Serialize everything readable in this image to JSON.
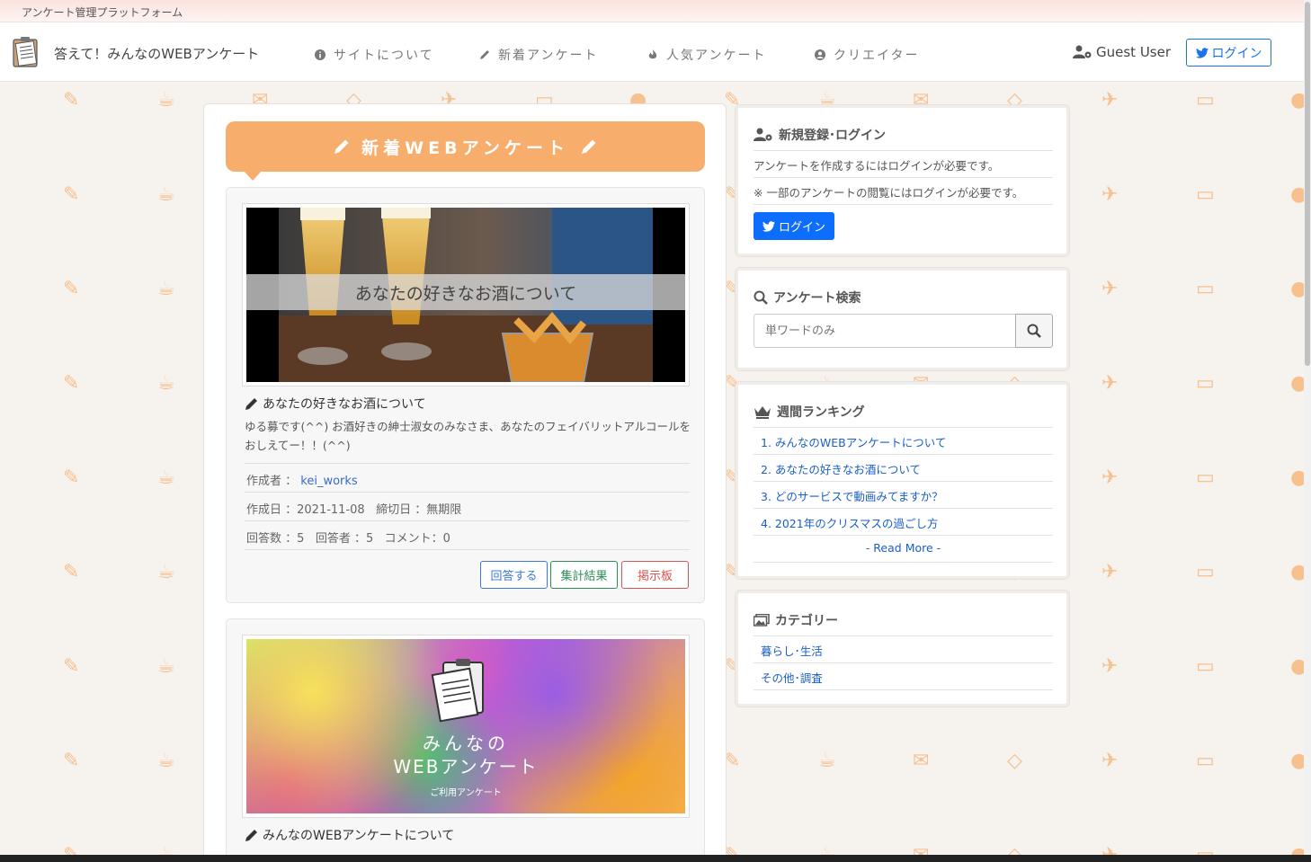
{
  "topstrip": {
    "title": "アンケート管理プラットフォーム"
  },
  "navbar": {
    "brand": "答えて！みんなのWEBアンケート",
    "items": [
      {
        "label": "サイトについて",
        "icon": "info-icon"
      },
      {
        "label": "新着アンケート",
        "icon": "pencil-icon"
      },
      {
        "label": "人気アンケート",
        "icon": "fire-icon"
      },
      {
        "label": "クリエイター",
        "icon": "user-circle-icon"
      }
    ],
    "user": "Guest User",
    "login": "ログイン"
  },
  "main": {
    "heading": "新着WEBアンケート",
    "cards": [
      {
        "thumb_caption": "あなたの好きなお酒について",
        "title": "あなたの好きなお酒について",
        "description": "ゆる募です(^^) お酒好きの紳士淑女のみなさま、あなたのフェイバリットアルコールをおしえてー！！(^^)",
        "author_label": "作成者 ：",
        "author": "kei_works",
        "created_label": "作成日 ：",
        "created": "2021-11-08",
        "deadline_label": "締切日 ：",
        "deadline": "無期限",
        "answers_label": "回答数 ：",
        "answers": "5",
        "respondents_label": "回答者 ：",
        "respondents": "5",
        "comments_label": "コメント：",
        "comments": "0",
        "buttons": {
          "answer": "回答する",
          "results": "集計結果",
          "board": "掲示板"
        }
      },
      {
        "thumb_line1": "みんなの",
        "thumb_line2": "WEBアンケート",
        "thumb_line3": "ご利用アンケート",
        "title": "みんなのWEBアンケートについて"
      }
    ]
  },
  "sidebar": {
    "login_box": {
      "title": "新規登録･ログイン",
      "line1": "アンケートを作成するにはログインが必要です。",
      "line2": "※ 一部のアンケートの閲覧にはログインが必要です。",
      "button": "ログイン"
    },
    "search_box": {
      "title": "アンケート検索",
      "placeholder": "単ワードのみ"
    },
    "ranking_box": {
      "title": "週間ランキング",
      "items": [
        "1. みんなのWEBアンケートについて",
        "2. あなたの好きなお酒について",
        "3. どのサービスで動画みてますか？",
        "4. 2021年のクリスマスの過ごし方"
      ],
      "more": "- Read More -"
    },
    "category_box": {
      "title": "カテゴリー",
      "items": [
        "暮らし･生活",
        "その他･調査"
      ]
    }
  },
  "colors": {
    "accent": "#f7ae6d",
    "link": "#1a5fc7",
    "twitter": "#0d6efd"
  }
}
